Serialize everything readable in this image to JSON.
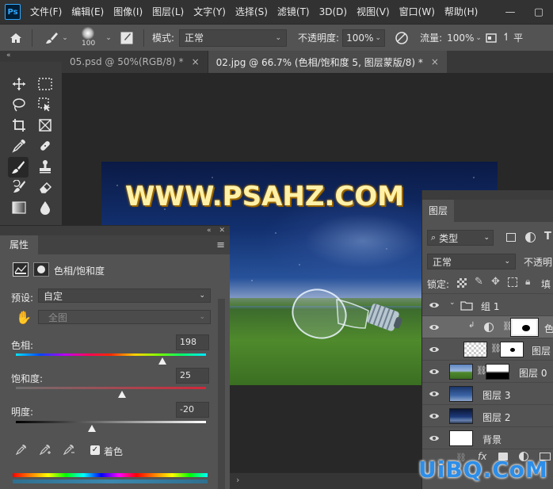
{
  "menubar": {
    "logo": "Ps",
    "items": [
      "文件(F)",
      "编辑(E)",
      "图像(I)",
      "图层(L)",
      "文字(Y)",
      "选择(S)",
      "滤镜(T)",
      "3D(D)",
      "视图(V)",
      "窗口(W)",
      "帮助(H)"
    ]
  },
  "options": {
    "brush_size": "100",
    "mode_label": "模式:",
    "mode_value": "正常",
    "opacity_label": "不透明度:",
    "opacity_value": "100%",
    "flow_label": "流量:",
    "flow_value": "100%",
    "partial_label": "平"
  },
  "tabs": [
    {
      "label": "05.psd @ 50%(RGB/8) *",
      "close": "×"
    },
    {
      "label": "02.jpg @ 66.7% (色相/饱和度 5, 图层蒙版/8) *",
      "close": "×"
    }
  ],
  "canvas": {
    "watermark": "WWW.PSAHZ.COM"
  },
  "properties": {
    "tab_label": "属性",
    "adjustment_title": "色相/饱和度",
    "preset_label": "预设:",
    "preset_value": "自定",
    "channel_value": "全图",
    "hue_label": "色相:",
    "hue_value": "198",
    "hue_level": 0.77,
    "saturation_label": "饱和度:",
    "saturation_value": "25",
    "saturation_level": 0.56,
    "lightness_label": "明度:",
    "lightness_value": "-20",
    "lightness_level": 0.4,
    "colorize_label": "着色",
    "colorize_checked": true
  },
  "layers": {
    "tab_label": "图层",
    "filter_label": "类型",
    "blend_mode": "正常",
    "opacity_label": "不透明",
    "lock_label": "锁定:",
    "fill_label": "填",
    "rows": [
      {
        "name": "组 1"
      },
      {
        "name": "色"
      },
      {
        "name": "图层"
      },
      {
        "name": "图层 0"
      },
      {
        "name": "图层 3"
      },
      {
        "name": "图层 2"
      },
      {
        "name": "背景"
      }
    ]
  },
  "status": {
    "nav_arrow": "›"
  },
  "branding": {
    "logo_text": "UiBQ.CoM"
  },
  "colors": {
    "panel": "#535353",
    "accent_blue": "#31a8ff"
  }
}
